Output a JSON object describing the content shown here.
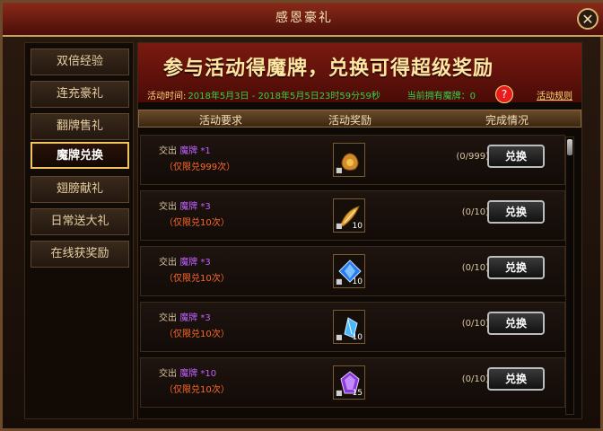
{
  "window": {
    "title": "感恩豪礼",
    "close_symbol": "✕"
  },
  "sidebar": {
    "items": [
      {
        "label": "双倍经验",
        "active": false
      },
      {
        "label": "连充豪礼",
        "active": false
      },
      {
        "label": "翻牌售礼",
        "active": false
      },
      {
        "label": "魔牌兑换",
        "active": true
      },
      {
        "label": "翅膀献礼",
        "active": false
      },
      {
        "label": "日常送大礼",
        "active": false
      },
      {
        "label": "在线获奖励",
        "active": false
      }
    ]
  },
  "banner": {
    "headline": "参与活动得魔牌，兑换可得超级奖励",
    "time_label": "活动时间:",
    "time_value": "2018年5月3日 - 2018年5月5日23时59分59秒",
    "count_label": "当前拥有魔牌：0",
    "help_symbol": "?",
    "rules_label": "活动规则"
  },
  "table": {
    "headers": {
      "requirement": "活动要求",
      "reward": "活动奖励",
      "status": "完成情况"
    },
    "rows": [
      {
        "req_prefix": "交出 ",
        "req_item": "魔牌 *1",
        "limit": "（仅限兑999次）",
        "reward_icon": "gold-bag-icon",
        "reward_qty": "",
        "progress": "(0/999)",
        "button": "兑换"
      },
      {
        "req_prefix": "交出 ",
        "req_item": "魔牌 *3",
        "limit": "（仅限兑10次）",
        "reward_icon": "golden-feather-icon",
        "reward_qty": "10",
        "progress": "(0/10)",
        "button": "兑换"
      },
      {
        "req_prefix": "交出 ",
        "req_item": "魔牌 *3",
        "limit": "（仅限兑10次）",
        "reward_icon": "blue-crystal-icon",
        "reward_qty": "10",
        "progress": "(0/10)",
        "button": "兑换"
      },
      {
        "req_prefix": "交出 ",
        "req_item": "魔牌 *3",
        "limit": "（仅限兑10次）",
        "reward_icon": "cyan-crystal-icon",
        "reward_qty": "10",
        "progress": "(0/10)",
        "button": "兑换"
      },
      {
        "req_prefix": "交出 ",
        "req_item": "魔牌 *10",
        "limit": "（仅限兑10次）",
        "reward_icon": "purple-gem-icon",
        "reward_qty": "15",
        "progress": "(0/10)",
        "button": "兑换"
      }
    ]
  }
}
